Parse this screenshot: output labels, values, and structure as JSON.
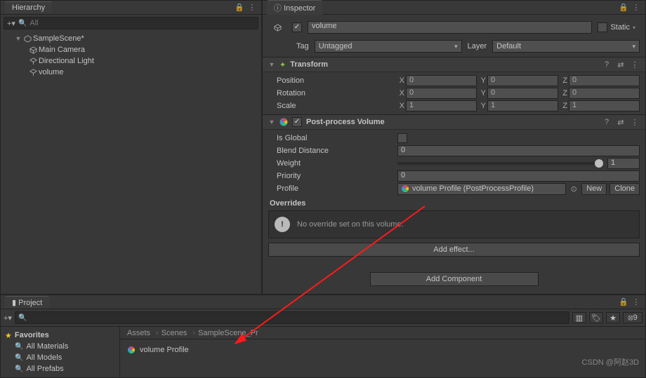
{
  "hierarchy": {
    "title": "Hierarchy",
    "search_placeholder": "All",
    "scene": "SampleScene*",
    "items": [
      "Main Camera",
      "Directional Light",
      "volume"
    ]
  },
  "inspector": {
    "title": "Inspector",
    "object_name": "volume",
    "static_label": "Static",
    "tag_label": "Tag",
    "tag_value": "Untagged",
    "layer_label": "Layer",
    "layer_value": "Default",
    "transform": {
      "title": "Transform",
      "rows": [
        {
          "label": "Position",
          "x": "0",
          "y": "0",
          "z": "0"
        },
        {
          "label": "Rotation",
          "x": "0",
          "y": "0",
          "z": "0"
        },
        {
          "label": "Scale",
          "x": "1",
          "y": "1",
          "z": "1"
        }
      ]
    },
    "ppv": {
      "title": "Post-process Volume",
      "is_global": "Is Global",
      "blend_distance": {
        "label": "Blend Distance",
        "value": "0"
      },
      "weight": {
        "label": "Weight",
        "value": "1"
      },
      "priority": {
        "label": "Priority",
        "value": "0"
      },
      "profile": {
        "label": "Profile",
        "value": "volume Profile (PostProcessProfile)",
        "new": "New",
        "clone": "Clone"
      },
      "overrides_label": "Overrides",
      "overrides_msg": "No override set on this volume.",
      "add_effect": "Add effect...",
      "add_component": "Add Component"
    }
  },
  "project": {
    "title": "Project",
    "favorites": "Favorites",
    "fav_items": [
      "All Materials",
      "All Models",
      "All Prefabs"
    ],
    "breadcrumb": [
      "Assets",
      "Scenes",
      "SampleScene_Pr"
    ],
    "asset": "volume Profile"
  },
  "watermark": "CSDN @阿赵3D"
}
